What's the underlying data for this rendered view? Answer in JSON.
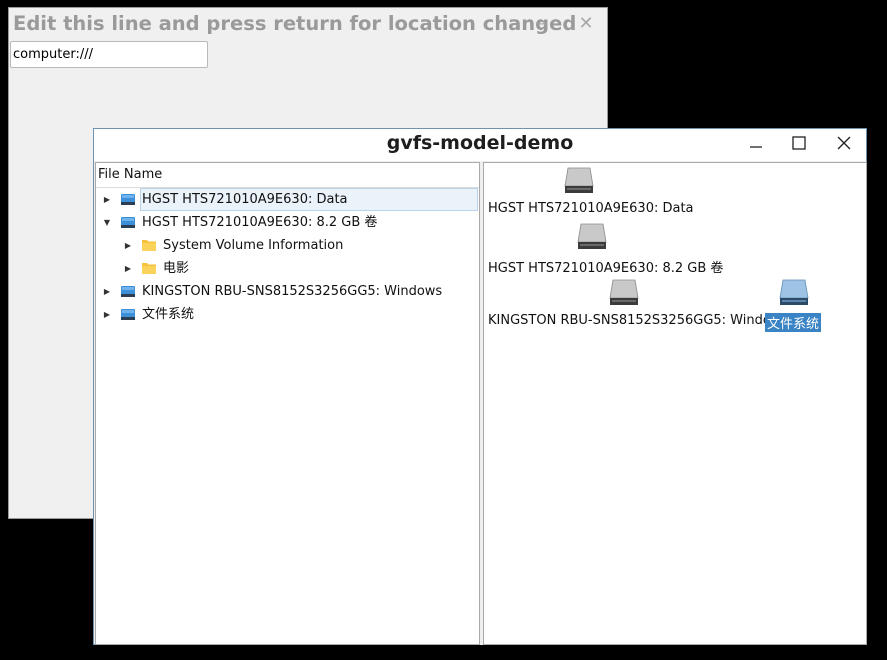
{
  "back_window": {
    "title": "Edit this line and press return for location changed",
    "minimize": "–",
    "close": "✕",
    "location_value": "computer:///"
  },
  "front_window": {
    "title": "gvfs-model-demo",
    "minimize": "—",
    "maximize": "☐",
    "close": "✕"
  },
  "tree": {
    "column_header": "File Name",
    "rows": [
      {
        "label": "HGST HTS721010A9E630: Data",
        "icon": "drive-icon",
        "expanded": false
      },
      {
        "label": "HGST HTS721010A9E630: 8.2 GB 卷",
        "icon": "drive-icon",
        "expanded": true
      },
      {
        "label": "System Volume Information",
        "icon": "folder-icon",
        "expanded": false
      },
      {
        "label": "电影",
        "icon": "folder-icon",
        "expanded": false
      },
      {
        "label": "KINGSTON RBU-SNS8152S3256GG5: Windows",
        "icon": "drive-icon",
        "expanded": false
      },
      {
        "label": "文件系统",
        "icon": "drive-icon",
        "expanded": false
      }
    ]
  },
  "icon_view": {
    "items": [
      {
        "label": "HGST HTS721010A9E630: Data",
        "icon": "hard-disk-icon"
      },
      {
        "label": "HGST HTS721010A9E630: 8.2 GB 卷",
        "icon": "hard-disk-icon"
      },
      {
        "label": "KINGSTON RBU-SNS8152S3256GG5: Windows",
        "icon": "hard-disk-icon"
      },
      {
        "label": "文件系统",
        "icon": "hard-disk-icon",
        "selected": true
      }
    ]
  },
  "colors": {
    "selection": "#3a83c4",
    "tree_selection": "#eaf2fa",
    "folder": "#f7c23e",
    "drive": "#3d8fd8"
  }
}
